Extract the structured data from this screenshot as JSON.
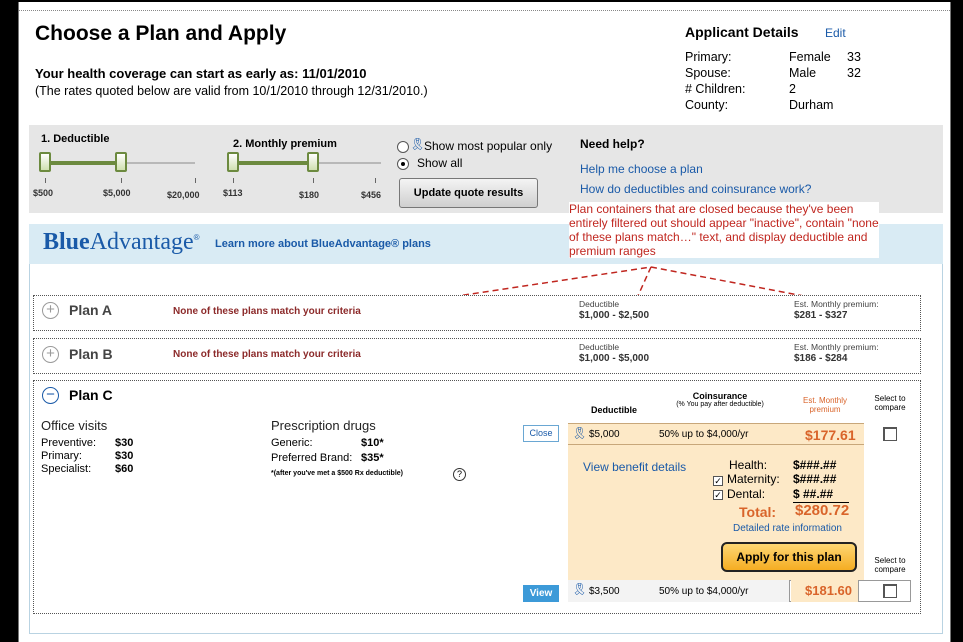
{
  "header": {
    "title": "Choose a Plan and Apply",
    "coverage": "Your health coverage can start as early as: 11/01/2010",
    "rates_note": "(The rates quoted below are valid from 10/1/2010 through 12/31/2010.)"
  },
  "applicant": {
    "title": "Applicant Details",
    "edit": "Edit",
    "rows": [
      {
        "label": "Primary:",
        "value": "Female",
        "num": "33"
      },
      {
        "label": "Spouse:",
        "value": "Male",
        "num": "32"
      },
      {
        "label": "# Children:",
        "value": "2",
        "num": ""
      },
      {
        "label": "County:",
        "value": "Durham",
        "num": ""
      }
    ]
  },
  "filters": {
    "deductible_label": "1. Deductible",
    "deductible_ticks": [
      "$500",
      "$5,000",
      "$20,000"
    ],
    "premium_label": "2. Monthly premium",
    "premium_ticks": [
      "$113",
      "$180",
      "$456"
    ],
    "show_popular": "Show most popular only",
    "show_all": "Show all",
    "selected_option": "Show all",
    "update_button": "Update quote results"
  },
  "help": {
    "title": "Need help?",
    "links": [
      "Help me choose a plan",
      "How do deductibles and coinsurance work?"
    ]
  },
  "annotation": "Plan containers that are closed because they've been entirely filtered out should appear \"inactive\", contain \"none of these plans match…\" text, and display deductible and premium ranges",
  "banner": {
    "brand_blue": "Blue",
    "brand_adv": "Advantage",
    "reg": "®",
    "learn_more": "Learn more about BlueAdvantage® plans"
  },
  "plans": [
    {
      "name": "Plan A",
      "status": "None of these plans match your criteria",
      "deductible_label": "Deductible",
      "deductible_range": "$1,000 - $2,500",
      "premium_label": "Est. Monthly premium:",
      "premium_range": "$281 - $327"
    },
    {
      "name": "Plan B",
      "status": "None of these plans match your criteria",
      "deductible_label": "Deductible",
      "deductible_range": "$1,000 - $5,000",
      "premium_label": "Est. Monthly premium:",
      "premium_range": "$186 - $284"
    }
  ],
  "plan_c": {
    "name": "Plan C",
    "office_visits": {
      "title": "Office visits",
      "rows": [
        {
          "label": "Preventive:",
          "value": "$30"
        },
        {
          "label": "Primary:",
          "value": "$30"
        },
        {
          "label": "Specialist:",
          "value": "$60"
        }
      ]
    },
    "prescription": {
      "title": "Prescription drugs",
      "rows": [
        {
          "label": "Generic:",
          "value": "$10*"
        },
        {
          "label": "Preferred Brand:",
          "value": "$35*"
        }
      ],
      "footnote": "*(after you've met a $500 Rx deductible)"
    },
    "close": "Close",
    "view": "View",
    "table_headers": {
      "deductible": "Deductible",
      "coinsurance": "Coinsurance",
      "coinsurance_sub": "(% You pay after deductible)",
      "premium": "Est. Monthly premium",
      "select": "Select to compare"
    },
    "options": [
      {
        "deductible": "$5,000",
        "coinsurance": "50% up to $4,000/yr",
        "premium": "$177.61"
      },
      {
        "deductible": "$3,500",
        "coinsurance": "50% up to $4,000/yr",
        "premium": "$181.60"
      }
    ],
    "view_benefit": "View benefit details",
    "addons": [
      {
        "label": "Health:",
        "value": "$###.##",
        "check": ""
      },
      {
        "label": "Maternity:",
        "value": "$###.##",
        "check": "✓"
      },
      {
        "label": "Dental:",
        "value": "$  ##.##",
        "check": "✓"
      }
    ],
    "total_label": "Total:",
    "total_value": "$280.72",
    "detailed_rate": "Detailed rate information",
    "apply": "Apply for this plan",
    "select_compare": "Select to compare",
    "colors": {
      "accent_orange": "#d9642a",
      "link_blue": "#1a5aa8",
      "warning_red": "#c0261f"
    }
  }
}
